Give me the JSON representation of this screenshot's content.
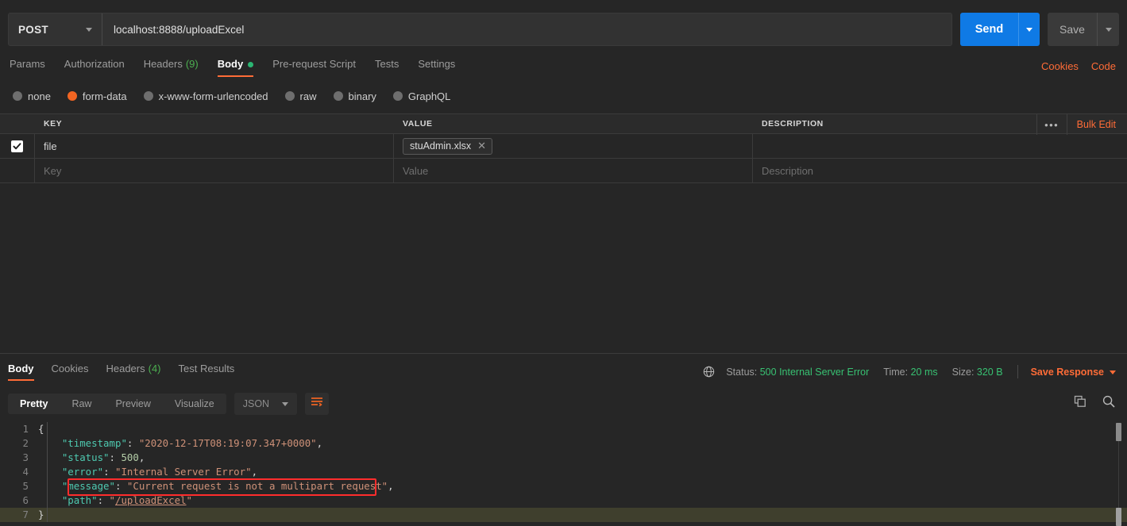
{
  "request": {
    "method": "POST",
    "url": "localhost:8888/uploadExcel",
    "send_label": "Send",
    "save_label": "Save",
    "tabs": [
      {
        "label": "Params",
        "count": "",
        "active": false
      },
      {
        "label": "Authorization",
        "count": "",
        "active": false
      },
      {
        "label": "Headers",
        "count": "(9)",
        "active": false
      },
      {
        "label": "Body",
        "count": "",
        "active": true
      },
      {
        "label": "Pre-request Script",
        "count": "",
        "active": false
      },
      {
        "label": "Tests",
        "count": "",
        "active": false
      },
      {
        "label": "Settings",
        "count": "",
        "active": false
      }
    ],
    "links": [
      {
        "label": "Cookies"
      },
      {
        "label": "Code"
      }
    ],
    "body_types": [
      {
        "label": "none",
        "selected": false
      },
      {
        "label": "form-data",
        "selected": true
      },
      {
        "label": "x-www-form-urlencoded",
        "selected": false
      },
      {
        "label": "raw",
        "selected": false
      },
      {
        "label": "binary",
        "selected": false
      },
      {
        "label": "GraphQL",
        "selected": false
      }
    ],
    "table": {
      "columns": [
        "KEY",
        "VALUE",
        "DESCRIPTION"
      ],
      "dots_label": "•••",
      "bulk_edit_label": "Bulk Edit",
      "rows": [
        {
          "checked": true,
          "key": "file",
          "value": "stuAdmin.xlsx",
          "value_is_file": true,
          "description": ""
        }
      ],
      "placeholder_row": {
        "key": "Key",
        "value": "Value",
        "description": "Description"
      }
    }
  },
  "response": {
    "tabs": [
      {
        "label": "Body",
        "count": "",
        "active": true
      },
      {
        "label": "Cookies",
        "count": "",
        "active": false
      },
      {
        "label": "Headers",
        "count": "(4)",
        "active": false
      },
      {
        "label": "Test Results",
        "count": "",
        "active": false
      }
    ],
    "status": {
      "status_label": "Status:",
      "status_value": "500 Internal Server Error",
      "time_label": "Time:",
      "time_value": "20 ms",
      "size_label": "Size:",
      "size_value": "320 B",
      "save_response_label": "Save Response"
    },
    "format_buttons": [
      {
        "label": "Pretty",
        "active": true
      },
      {
        "label": "Raw",
        "active": false
      },
      {
        "label": "Preview",
        "active": false
      },
      {
        "label": "Visualize",
        "active": false
      }
    ],
    "language": "JSON",
    "body_json": {
      "timestamp": "2020-12-17T08:19:07.347+0000",
      "status": 500,
      "error": "Internal Server Error",
      "message": "Current request is not a multipart request",
      "path": "/uploadExcel"
    },
    "code_lines": [
      {
        "n": "1",
        "segments": [
          {
            "t": "{",
            "c": "cp"
          }
        ]
      },
      {
        "n": "2",
        "segments": [
          {
            "t": "    ",
            "c": "cp"
          },
          {
            "t": "\"timestamp\"",
            "c": "ck"
          },
          {
            "t": ": ",
            "c": "cp"
          },
          {
            "t": "\"2020-12-17T08:19:07.347+0000\"",
            "c": "cs"
          },
          {
            "t": ",",
            "c": "cp"
          }
        ]
      },
      {
        "n": "3",
        "segments": [
          {
            "t": "    ",
            "c": "cp"
          },
          {
            "t": "\"status\"",
            "c": "ck"
          },
          {
            "t": ": ",
            "c": "cp"
          },
          {
            "t": "500",
            "c": "cn"
          },
          {
            "t": ",",
            "c": "cp"
          }
        ]
      },
      {
        "n": "4",
        "segments": [
          {
            "t": "    ",
            "c": "cp"
          },
          {
            "t": "\"error\"",
            "c": "ck"
          },
          {
            "t": ": ",
            "c": "cp"
          },
          {
            "t": "\"Internal Server Error\"",
            "c": "cs"
          },
          {
            "t": ",",
            "c": "cp"
          }
        ]
      },
      {
        "n": "5",
        "segments": [
          {
            "t": "    ",
            "c": "cp"
          },
          {
            "t": "\"message\"",
            "c": "ck"
          },
          {
            "t": ": ",
            "c": "cp"
          },
          {
            "t": "\"Current request is not a multipart request\"",
            "c": "cs"
          },
          {
            "t": ",",
            "c": "cp"
          }
        ]
      },
      {
        "n": "6",
        "segments": [
          {
            "t": "    ",
            "c": "cp"
          },
          {
            "t": "\"path\"",
            "c": "ck"
          },
          {
            "t": ": ",
            "c": "cp"
          },
          {
            "t": "\"",
            "c": "cs"
          },
          {
            "t": "/uploadExcel",
            "c": "cu"
          },
          {
            "t": "\"",
            "c": "cs"
          }
        ]
      },
      {
        "n": "7",
        "segments": [
          {
            "t": "}",
            "c": "cp"
          }
        ],
        "highlight": true
      }
    ]
  }
}
